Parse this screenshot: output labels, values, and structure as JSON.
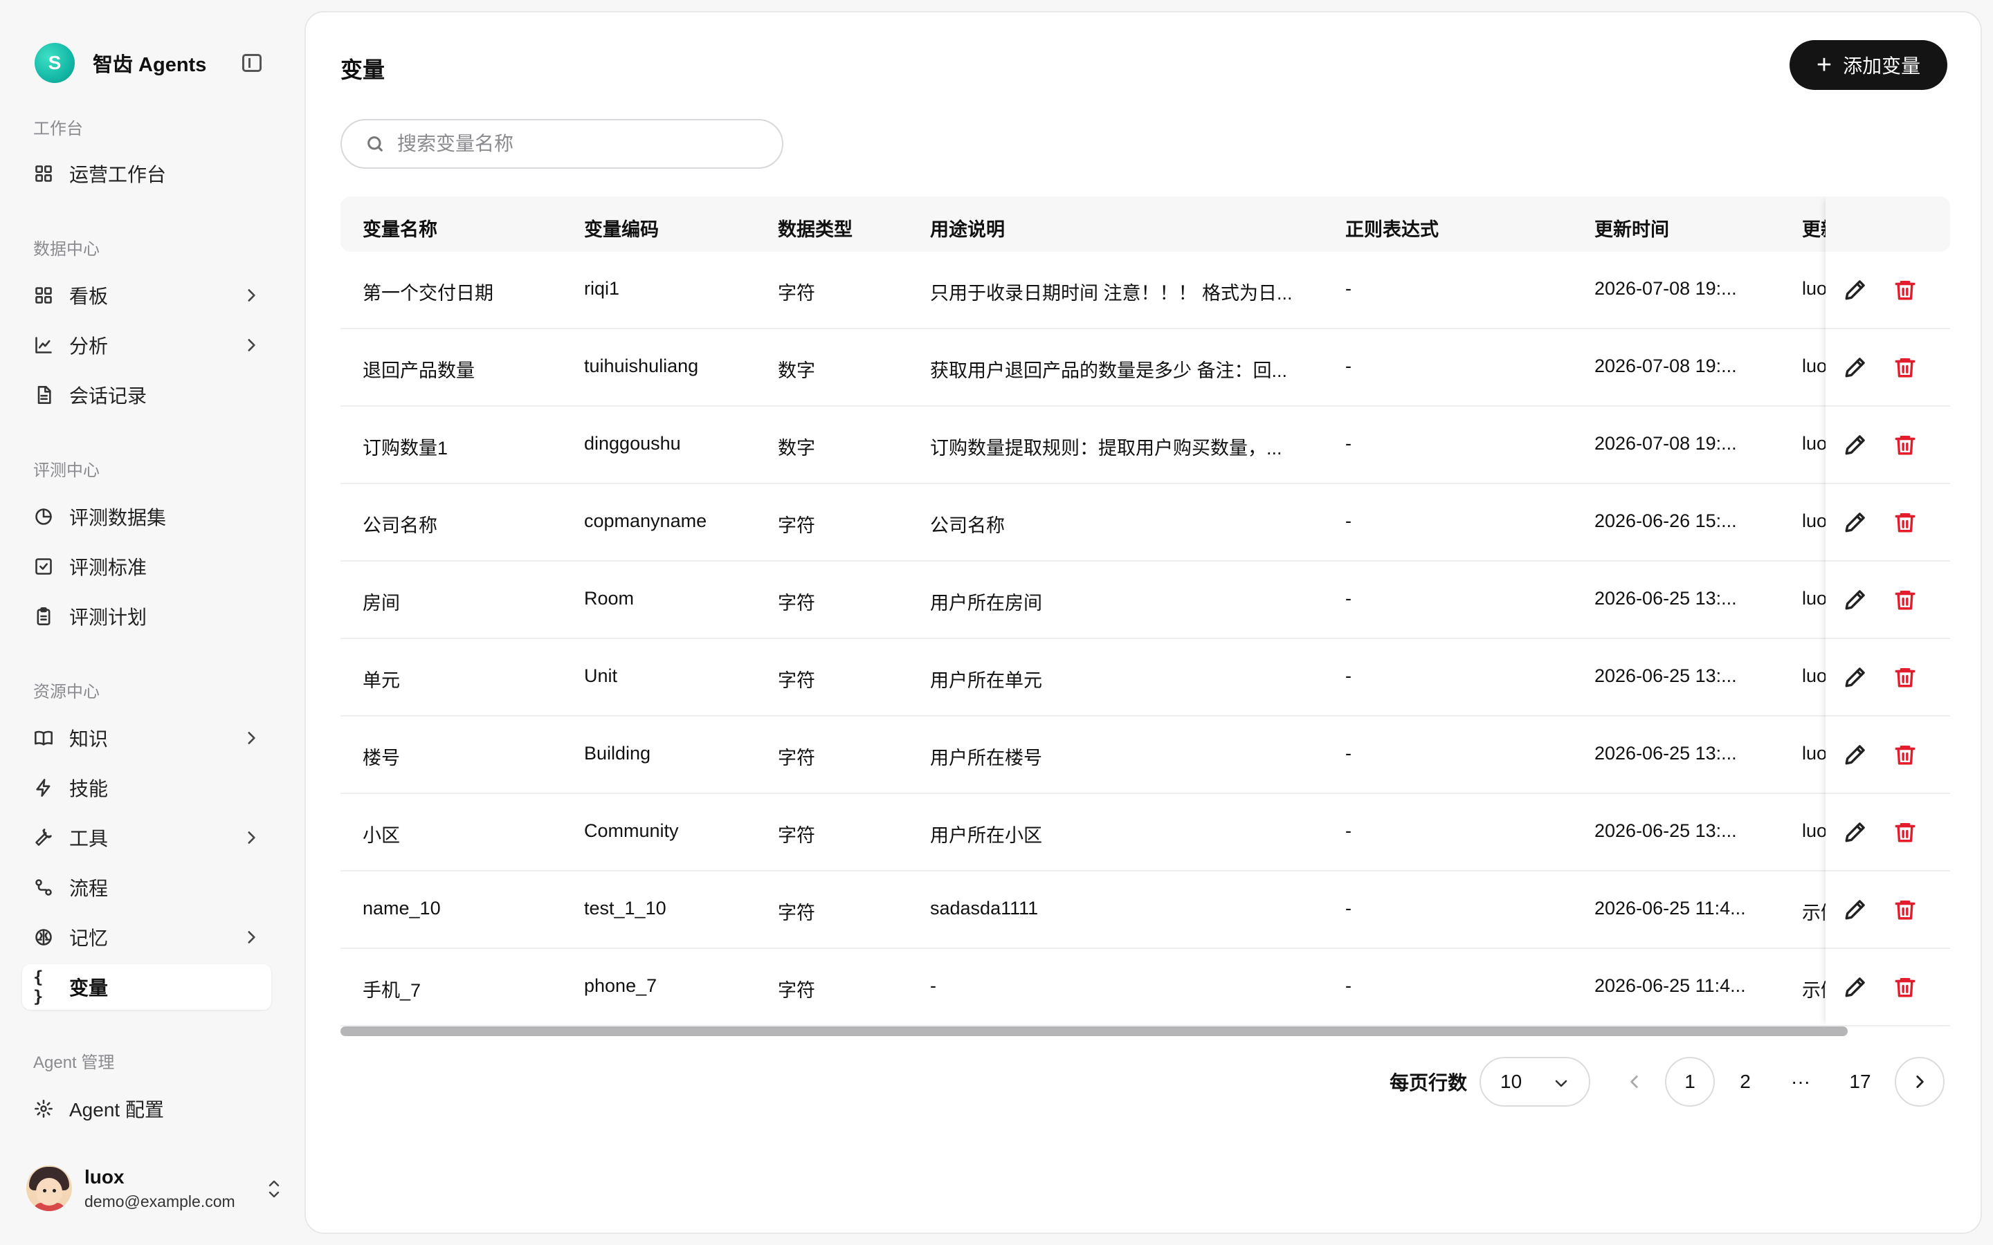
{
  "brand": {
    "logo_letter": "S",
    "name": "智齿 Agents"
  },
  "sidebar": {
    "sections": [
      {
        "label": "工作台"
      },
      {
        "label": "数据中心"
      },
      {
        "label": "评测中心"
      },
      {
        "label": "资源中心"
      },
      {
        "label": "Agent 管理"
      }
    ],
    "items": [
      {
        "label": "运营工作台",
        "icon": "grid-icon"
      },
      {
        "label": "看板",
        "icon": "grid-icon",
        "has_children": true
      },
      {
        "label": "分析",
        "icon": "line-chart-icon",
        "has_children": true
      },
      {
        "label": "会话记录",
        "icon": "document-icon"
      },
      {
        "label": "评测数据集",
        "icon": "pie-chart-icon"
      },
      {
        "label": "评测标准",
        "icon": "checkbox-icon"
      },
      {
        "label": "评测计划",
        "icon": "clipboard-icon"
      },
      {
        "label": "知识",
        "icon": "book-icon",
        "has_children": true
      },
      {
        "label": "技能",
        "icon": "lightning-icon"
      },
      {
        "label": "工具",
        "icon": "wrench-icon",
        "has_children": true
      },
      {
        "label": "流程",
        "icon": "workflow-icon"
      },
      {
        "label": "记忆",
        "icon": "brain-icon",
        "has_children": true
      },
      {
        "label": "变量",
        "icon": "braces-icon",
        "active": true
      },
      {
        "label": "Agent 配置",
        "icon": "gear-icon"
      }
    ],
    "braces_glyph": "{ }"
  },
  "user": {
    "name": "luox",
    "email": "demo@example.com"
  },
  "main": {
    "title": "变量",
    "add_button": "添加变量",
    "search_placeholder": "搜索变量名称",
    "columns": [
      "变量名称",
      "变量编码",
      "数据类型",
      "用途说明",
      "正则表达式",
      "更新时间",
      "更新人"
    ],
    "rows": [
      [
        "第一个交付日期",
        "riqi1",
        "字符",
        "只用于收录日期时间 注意！！！ 格式为日...",
        "-",
        "2026-07-08 19:...",
        "luox"
      ],
      [
        "退回产品数量",
        "tuihuishuliang",
        "数字",
        "获取用户退回产品的数量是多少 备注：回...",
        "-",
        "2026-07-08 19:...",
        "luox"
      ],
      [
        "订购数量1",
        "dinggoushu",
        "数字",
        "订购数量提取规则：提取用户购买数量，...",
        "-",
        "2026-07-08 19:...",
        "luox"
      ],
      [
        "公司名称",
        "copmanyname",
        "字符",
        "公司名称",
        "-",
        "2026-06-26 15:...",
        "luox"
      ],
      [
        "房间",
        "Room",
        "字符",
        "用户所在房间",
        "-",
        "2026-06-25 13:...",
        "luox"
      ],
      [
        "单元",
        "Unit",
        "字符",
        "用户所在单元",
        "-",
        "2026-06-25 13:...",
        "luox"
      ],
      [
        "楼号",
        "Building",
        "字符",
        "用户所在楼号",
        "-",
        "2026-06-25 13:...",
        "luox"
      ],
      [
        "小区",
        "Community",
        "字符",
        "用户所在小区",
        "-",
        "2026-06-25 13:...",
        "luox"
      ],
      [
        "name_10",
        "test_1_10",
        "字符",
        "sadasda1111",
        "-",
        "2026-06-25 11:4...",
        "示例"
      ],
      [
        "手机_7",
        "phone_7",
        "字符",
        "-",
        "-",
        "2026-06-25 11:4...",
        "示例"
      ]
    ]
  },
  "pagination": {
    "rows_per_page_label": "每页行数",
    "rows_per_page": "10",
    "pages": [
      "1",
      "2",
      "···",
      "17"
    ],
    "current": "1"
  },
  "colors": {
    "accent": "#141414",
    "danger": "#e11d2e",
    "brand": "#14b8a6"
  }
}
